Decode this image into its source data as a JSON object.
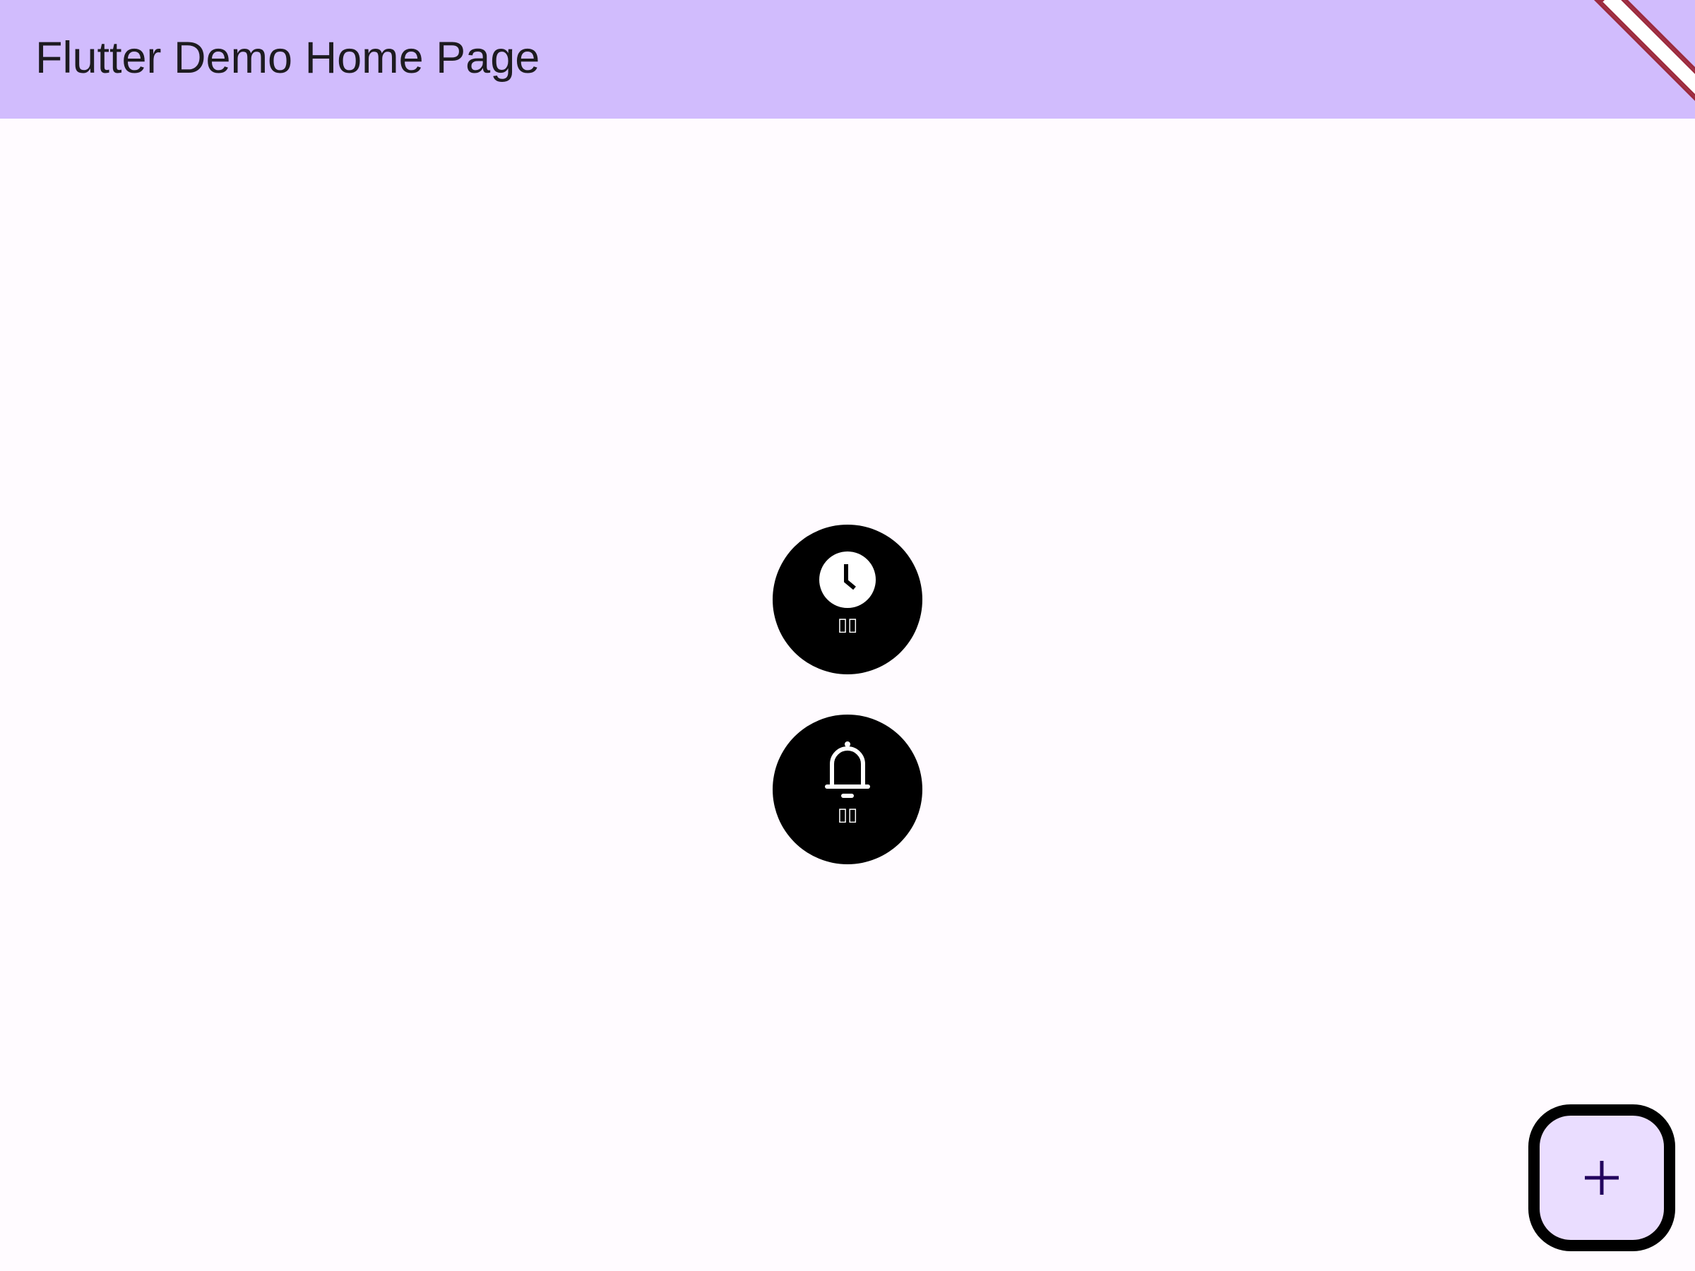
{
  "appbar": {
    "title": "Flutter Demo Home Page",
    "color": "#d1bcfd"
  },
  "debug_banner": {
    "color": "#9c2a3e"
  },
  "buttons": [
    {
      "icon": "clock-icon",
      "label": "▯▯"
    },
    {
      "icon": "bell-icon",
      "label": "▯▯"
    }
  ],
  "fab": {
    "icon": "add-icon",
    "background": "#eaddff",
    "icon_color": "#21005d"
  },
  "page": {
    "background": "#fffbff"
  }
}
